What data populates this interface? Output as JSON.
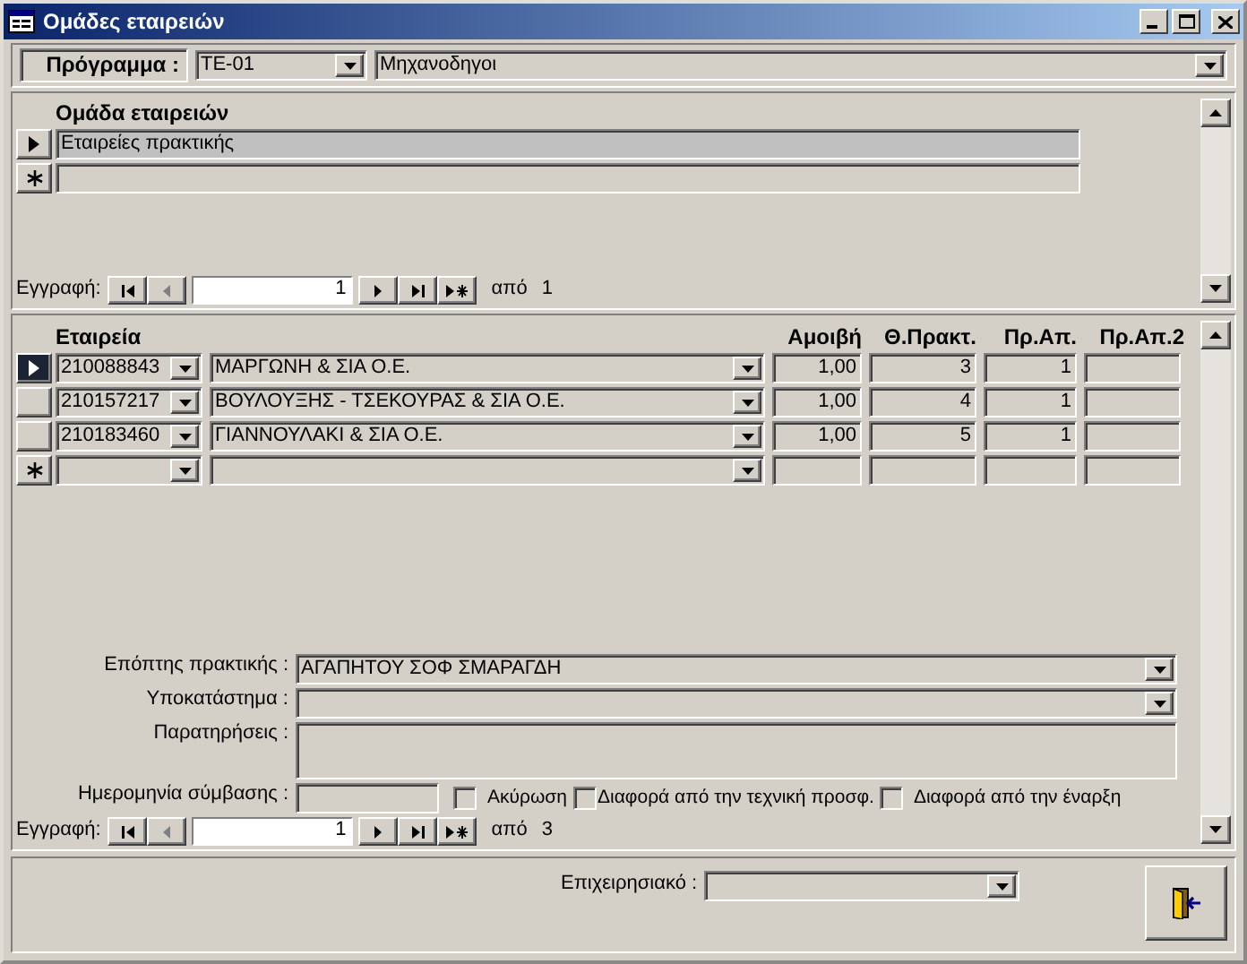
{
  "window": {
    "title": "Ομάδες εταιρειών"
  },
  "program": {
    "label": "Πρόγραμμα :",
    "code": "TE-01",
    "name": "Μηχανοδηγοι"
  },
  "groups": {
    "column": "Ομάδα εταιρειών",
    "rows": [
      {
        "kind": "record",
        "selected": true,
        "name": "Εταιρείες πρακτικής"
      },
      {
        "kind": "new",
        "selected": false
      }
    ]
  },
  "groups_nav": {
    "label": "Εγγραφή:",
    "current": "1",
    "of": "από",
    "total": "1",
    "buttons": [
      {
        "kind": "first",
        "disabled": false
      },
      {
        "kind": "prev",
        "disabled": true
      },
      {
        "kind": "next",
        "disabled": false
      },
      {
        "kind": "last",
        "disabled": false
      },
      {
        "kind": "new",
        "disabled": false
      }
    ]
  },
  "companies": {
    "columns": [
      "Εταιρεία",
      "Αμοιβή",
      "Θ.Πρακτ.",
      "Πρ.Απ.",
      "Πρ.Απ.2"
    ],
    "rows": [
      {
        "kind": "record",
        "selected": true,
        "code": "210088843",
        "name": "ΜΑΡΓΩΝΗ & ΣΙΑ Ο.Ε.",
        "fee": "1,00",
        "hours": "3",
        "pr_ap": "1"
      },
      {
        "kind": "record",
        "selected": false,
        "code": "210157217",
        "name": "ΒΟΥΛΟΥΞΗΣ - ΤΣΕΚΟΥΡΑΣ & ΣΙΑ Ο.Ε.",
        "fee": "1,00",
        "hours": "4",
        "pr_ap": "1"
      },
      {
        "kind": "record",
        "selected": false,
        "code": "210183460",
        "name": "ΓΙΑΝΝΟΥΛΑΚΙ & ΣΙΑ Ο.Ε.",
        "fee": "1,00",
        "hours": "5",
        "pr_ap": "1"
      },
      {
        "kind": "new",
        "selected": false
      }
    ]
  },
  "details": {
    "supervisor": {
      "label": "Επόπτης πρακτικής :",
      "value": "ΑΓΑΠΗΤΟΥ ΣΟΦ ΣΜΑΡΑΓΔΗ"
    },
    "branch": {
      "label": "Υποκατάστημα :"
    },
    "notes": {
      "label": "Παρατηρήσεις :"
    },
    "contract_date": {
      "label": "Ημερομηνία σύμβασης :"
    },
    "checkboxes": [
      {
        "label": "Ακύρωση",
        "checked": false
      },
      {
        "label": "Διαφορά από την τεχνική προσφ.",
        "checked": false
      },
      {
        "label": "Διαφορά από την έναρξη",
        "checked": false
      }
    ]
  },
  "companies_nav": {
    "label": "Εγγραφή:",
    "current": "1",
    "of": "από",
    "total": "3",
    "buttons": [
      {
        "kind": "first",
        "disabled": false
      },
      {
        "kind": "prev",
        "disabled": true
      },
      {
        "kind": "next",
        "disabled": false
      },
      {
        "kind": "last",
        "disabled": false
      },
      {
        "kind": "new",
        "disabled": false
      }
    ]
  },
  "footer": {
    "label": "Επιχειρησιακό :"
  }
}
